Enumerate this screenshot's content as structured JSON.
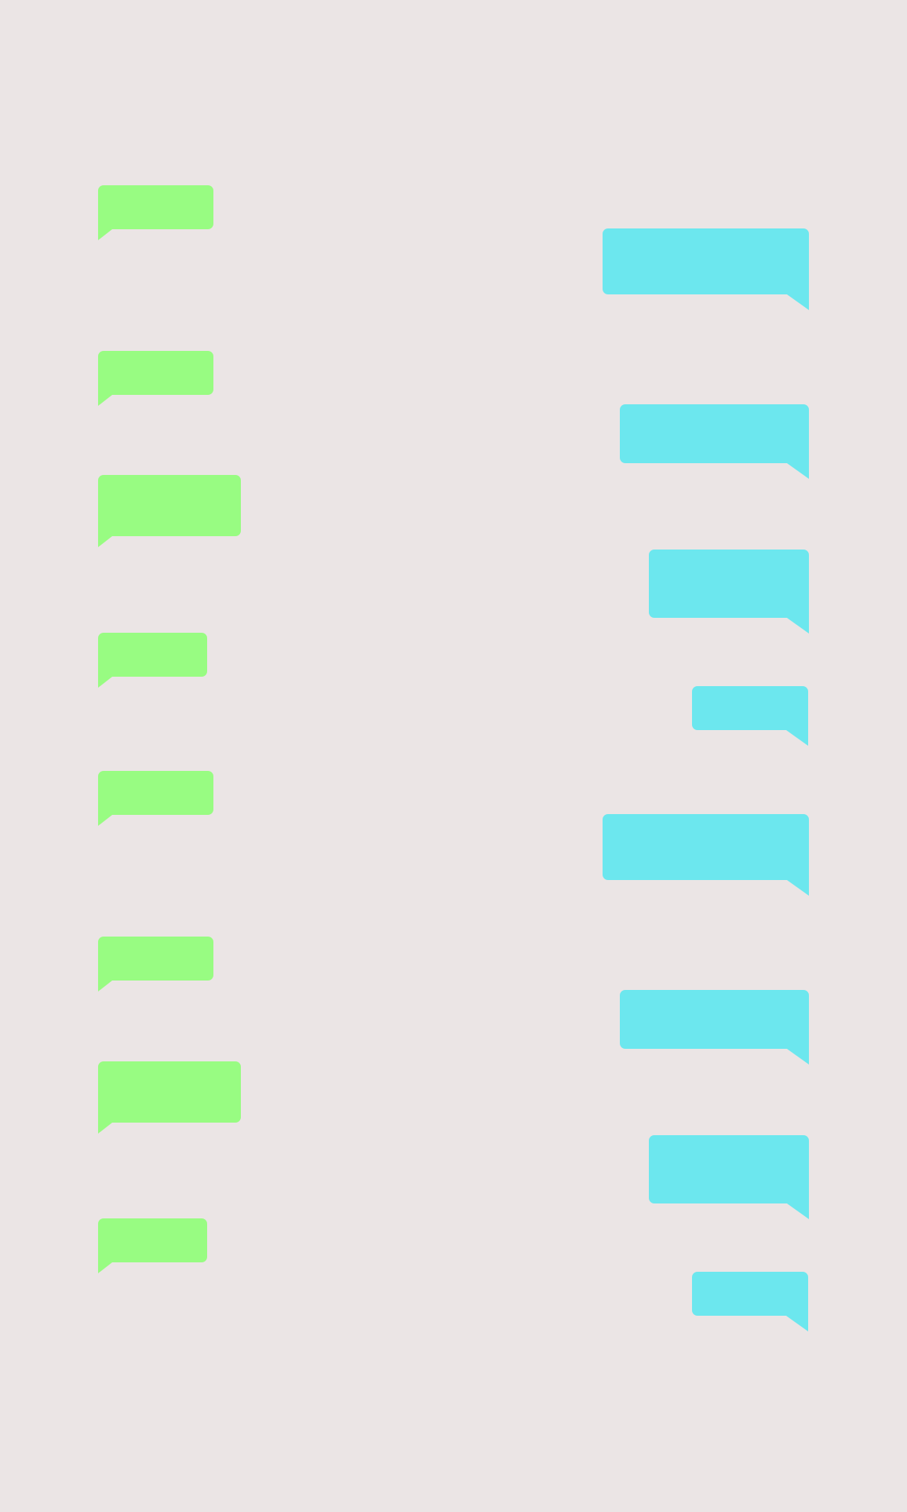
{
  "theme": {
    "background": "#ebe5e5",
    "incoming_bubble_color": "#98fc82",
    "outgoing_bubble_color": "#6ce7ee"
  },
  "incoming_messages": [
    {
      "text": ""
    },
    {
      "text": ""
    },
    {
      "text": ""
    },
    {
      "text": ""
    },
    {
      "text": ""
    },
    {
      "text": ""
    },
    {
      "text": ""
    },
    {
      "text": ""
    }
  ],
  "outgoing_messages": [
    {
      "text": ""
    },
    {
      "text": ""
    },
    {
      "text": ""
    },
    {
      "text": ""
    },
    {
      "text": ""
    },
    {
      "text": ""
    },
    {
      "text": ""
    },
    {
      "text": ""
    }
  ]
}
